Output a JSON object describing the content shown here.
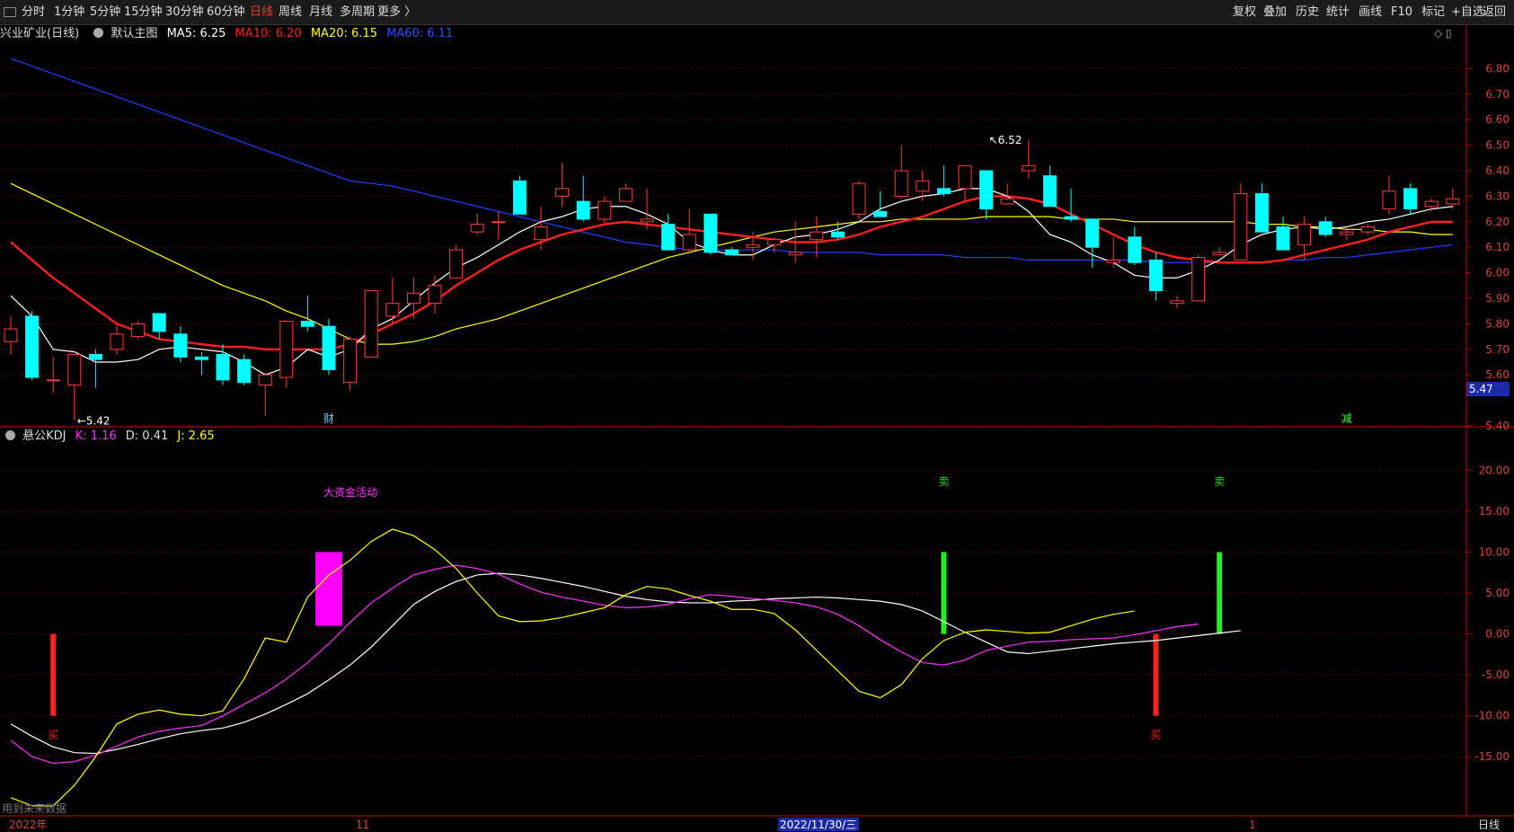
{
  "toolbar": {
    "periods": [
      "分时",
      "1分钟",
      "5分钟",
      "15分钟",
      "30分钟",
      "60分钟",
      "日线",
      "周线",
      "月线",
      "多周期",
      "更多 〉"
    ],
    "active_period": "日线",
    "right_buttons": [
      "复权",
      "叠加",
      "历史",
      "统计",
      "画线",
      "F10",
      "标记",
      "+自选",
      "返回"
    ]
  },
  "main_info": {
    "stock": "兴业矿业(日线)",
    "chart_label": "默认主图",
    "ma5": "MA5: 6.25",
    "ma10": "MA10: 6.20",
    "ma20": "MA20: 6.15",
    "ma60": "MA60: 6.11"
  },
  "kdj_info": {
    "name": "悬公KDJ",
    "k": "K: 1.16",
    "d": "D: 0.41",
    "j": "J: 2.65"
  },
  "price_tag": "5.47",
  "footer": {
    "left_note": "用到未来数据",
    "axis_labels": [
      "2022年",
      "11",
      "2022/11/30/三",
      "1"
    ],
    "period": "日线"
  },
  "colors": {
    "up": "#ff3d3d",
    "down": "#00ffff",
    "ma5": "#ffffff",
    "ma10": "#ff2020",
    "ma20": "#ffff00",
    "ma60": "#2040ff",
    "k": "#ffffff",
    "d": "#ff33ff",
    "j": "#ffff00",
    "grid": "#5a0000",
    "axis": "#c00000"
  },
  "chart_data": [
    {
      "type": "candlestick",
      "title": "兴业矿业(日线)",
      "ylim": [
        5.4,
        6.9
      ],
      "yticks": [
        "6.80",
        "6.70",
        "6.60",
        "6.50",
        "6.40",
        "6.30",
        "6.20",
        "6.10",
        "6.00",
        "5.90",
        "5.80",
        "5.70",
        "5.60",
        "5.40"
      ],
      "annotations": [
        {
          "text": "5.42",
          "candle": 3
        },
        {
          "text": "6.52",
          "candle": 46
        },
        {
          "text": "财",
          "candle": 15
        },
        {
          "text": "减",
          "candle": 63
        }
      ],
      "candles": [
        [
          5.73,
          5.78,
          5.68,
          5.83
        ],
        [
          5.83,
          5.59,
          5.58,
          5.85
        ],
        [
          5.58,
          5.58,
          5.53,
          5.67
        ],
        [
          5.56,
          5.68,
          5.42,
          5.68
        ],
        [
          5.68,
          5.66,
          5.55,
          5.7
        ],
        [
          5.7,
          5.76,
          5.68,
          5.8
        ],
        [
          5.75,
          5.8,
          5.74,
          5.81
        ],
        [
          5.84,
          5.77,
          5.74,
          5.84
        ],
        [
          5.76,
          5.67,
          5.65,
          5.79
        ],
        [
          5.67,
          5.66,
          5.6,
          5.69
        ],
        [
          5.68,
          5.58,
          5.56,
          5.72
        ],
        [
          5.66,
          5.57,
          5.56,
          5.68
        ],
        [
          5.56,
          5.6,
          5.44,
          5.61
        ],
        [
          5.59,
          5.81,
          5.55,
          5.81
        ],
        [
          5.81,
          5.79,
          5.77,
          5.91
        ],
        [
          5.79,
          5.62,
          5.6,
          5.82
        ],
        [
          5.57,
          5.74,
          5.54,
          5.75
        ],
        [
          5.67,
          5.93,
          5.67,
          5.93
        ],
        [
          5.83,
          5.88,
          5.8,
          5.98
        ],
        [
          5.88,
          5.92,
          5.82,
          5.98
        ],
        [
          5.88,
          5.95,
          5.84,
          5.99
        ],
        [
          5.98,
          6.09,
          5.99,
          6.11
        ],
        [
          6.16,
          6.19,
          6.15,
          6.23
        ],
        [
          6.2,
          6.2,
          6.13,
          6.24
        ],
        [
          6.36,
          6.23,
          6.23,
          6.38
        ],
        [
          6.13,
          6.18,
          6.09,
          6.26
        ],
        [
          6.3,
          6.33,
          6.26,
          6.43
        ],
        [
          6.28,
          6.21,
          6.2,
          6.38
        ],
        [
          6.21,
          6.28,
          6.19,
          6.3
        ],
        [
          6.28,
          6.33,
          6.3,
          6.35
        ],
        [
          6.2,
          6.21,
          6.17,
          6.33
        ],
        [
          6.19,
          6.09,
          6.09,
          6.23
        ],
        [
          6.09,
          6.15,
          6.08,
          6.25
        ],
        [
          6.23,
          6.08,
          6.07,
          6.23
        ],
        [
          6.09,
          6.07,
          6.07,
          6.1
        ],
        [
          6.1,
          6.11,
          6.05,
          6.16
        ],
        [
          6.11,
          6.13,
          6.08,
          6.14
        ],
        [
          6.07,
          6.08,
          6.04,
          6.2
        ],
        [
          6.13,
          6.16,
          6.06,
          6.22
        ],
        [
          6.16,
          6.14,
          6.13,
          6.2
        ],
        [
          6.23,
          6.35,
          6.21,
          6.36
        ],
        [
          6.24,
          6.22,
          6.22,
          6.32
        ],
        [
          6.3,
          6.4,
          6.29,
          6.5
        ],
        [
          6.32,
          6.36,
          6.28,
          6.4
        ],
        [
          6.33,
          6.31,
          6.3,
          6.42
        ],
        [
          6.33,
          6.42,
          6.28,
          6.42
        ],
        [
          6.4,
          6.25,
          6.21,
          6.4
        ],
        [
          6.27,
          6.29,
          6.28,
          6.35
        ],
        [
          6.4,
          6.42,
          6.37,
          6.52
        ],
        [
          6.38,
          6.26,
          6.26,
          6.42
        ],
        [
          6.22,
          6.21,
          6.2,
          6.33
        ],
        [
          6.21,
          6.1,
          6.02,
          6.21
        ],
        [
          6.04,
          6.05,
          6.02,
          6.14
        ],
        [
          6.14,
          6.04,
          6.03,
          6.18
        ],
        [
          6.05,
          5.93,
          5.89,
          6.08
        ],
        [
          5.88,
          5.89,
          5.86,
          5.91
        ],
        [
          5.89,
          6.06,
          5.9,
          6.07
        ],
        [
          6.07,
          6.08,
          6.08,
          6.1
        ],
        [
          6.05,
          6.31,
          6.05,
          6.35
        ],
        [
          6.31,
          6.16,
          6.16,
          6.35
        ],
        [
          6.18,
          6.09,
          6.1,
          6.22
        ],
        [
          6.11,
          6.19,
          6.05,
          6.22
        ],
        [
          6.2,
          6.15,
          6.14,
          6.22
        ],
        [
          6.15,
          6.16,
          6.13,
          6.18
        ],
        [
          6.16,
          6.18,
          6.15,
          6.19
        ],
        [
          6.25,
          6.32,
          6.23,
          6.38
        ],
        [
          6.33,
          6.25,
          6.23,
          6.35
        ],
        [
          6.26,
          6.28,
          6.24,
          6.29
        ],
        [
          6.27,
          6.29,
          6.25,
          6.33
        ]
      ],
      "ma5": [
        5.91,
        5.83,
        5.7,
        5.69,
        5.65,
        5.65,
        5.66,
        5.7,
        5.71,
        5.7,
        5.69,
        5.65,
        5.6,
        5.63,
        5.7,
        5.67,
        5.7,
        5.78,
        5.82,
        5.89,
        5.96,
        6.02,
        6.06,
        6.11,
        6.16,
        6.2,
        6.22,
        6.25,
        6.26,
        6.26,
        6.23,
        6.19,
        6.12,
        6.09,
        6.07,
        6.07,
        6.11,
        6.14,
        6.15,
        6.17,
        6.2,
        6.25,
        6.28,
        6.3,
        6.31,
        6.33,
        6.33,
        6.3,
        6.24,
        6.15,
        6.12,
        6.07,
        6.04,
        5.99,
        5.98,
        5.98,
        6.01,
        6.05,
        6.11,
        6.15,
        6.17,
        6.18,
        6.17,
        6.18,
        6.2,
        6.21,
        6.23,
        6.25,
        6.26
      ],
      "ma10": [
        6.12,
        6.05,
        5.98,
        5.92,
        5.86,
        5.8,
        5.77,
        5.74,
        5.73,
        5.72,
        5.71,
        5.71,
        5.7,
        5.7,
        5.7,
        5.7,
        5.72,
        5.76,
        5.8,
        5.84,
        5.89,
        5.95,
        6.0,
        6.05,
        6.09,
        6.12,
        6.15,
        6.17,
        6.19,
        6.2,
        6.19,
        6.18,
        6.17,
        6.16,
        6.15,
        6.14,
        6.13,
        6.12,
        6.12,
        6.13,
        6.15,
        6.18,
        6.2,
        6.22,
        6.25,
        6.28,
        6.3,
        6.3,
        6.29,
        6.27,
        6.23,
        6.19,
        6.15,
        6.11,
        6.08,
        6.06,
        6.05,
        6.04,
        6.04,
        6.04,
        6.05,
        6.07,
        6.09,
        6.11,
        6.13,
        6.16,
        6.18,
        6.2,
        6.2
      ],
      "ma20": [
        6.35,
        6.31,
        6.27,
        6.23,
        6.19,
        6.15,
        6.11,
        6.07,
        6.03,
        5.99,
        5.95,
        5.92,
        5.89,
        5.85,
        5.82,
        5.78,
        5.74,
        5.72,
        5.72,
        5.73,
        5.75,
        5.78,
        5.8,
        5.82,
        5.85,
        5.88,
        5.91,
        5.94,
        5.97,
        6.0,
        6.03,
        6.06,
        6.08,
        6.1,
        6.12,
        6.14,
        6.16,
        6.17,
        6.18,
        6.19,
        6.2,
        6.2,
        6.21,
        6.21,
        6.21,
        6.21,
        6.22,
        6.22,
        6.22,
        6.22,
        6.21,
        6.21,
        6.21,
        6.2,
        6.2,
        6.2,
        6.2,
        6.2,
        6.2,
        6.19,
        6.19,
        6.18,
        6.18,
        6.17,
        6.17,
        6.16,
        6.16,
        6.15,
        6.15
      ],
      "ma60": [
        6.84,
        6.81,
        6.78,
        6.75,
        6.72,
        6.69,
        6.66,
        6.63,
        6.6,
        6.57,
        6.54,
        6.51,
        6.48,
        6.45,
        6.42,
        6.39,
        6.36,
        6.35,
        6.34,
        6.32,
        6.3,
        6.28,
        6.26,
        6.24,
        6.22,
        6.2,
        6.18,
        6.16,
        6.14,
        6.12,
        6.11,
        6.1,
        6.09,
        6.09,
        6.09,
        6.09,
        6.09,
        6.08,
        6.08,
        6.08,
        6.08,
        6.07,
        6.07,
        6.07,
        6.07,
        6.06,
        6.06,
        6.06,
        6.05,
        6.05,
        6.05,
        6.05,
        6.05,
        6.05,
        6.04,
        6.04,
        6.04,
        6.04,
        6.04,
        6.04,
        6.05,
        6.05,
        6.06,
        6.06,
        6.07,
        6.08,
        6.09,
        6.1,
        6.11
      ]
    },
    {
      "type": "line",
      "title": "悬公KDJ",
      "ylim": [
        -22.0,
        23.0
      ],
      "yticks": [
        "20.00",
        "15.00",
        "10.00",
        "5.00",
        "0.00",
        "-5.00",
        "-10.00",
        "-15.00"
      ],
      "k": [
        -11.0,
        -12.5,
        -13.8,
        -14.5,
        -14.6,
        -14.1,
        -13.5,
        -12.8,
        -12.2,
        -11.8,
        -11.5,
        -10.8,
        -9.8,
        -8.6,
        -7.3,
        -5.6,
        -3.8,
        -1.6,
        1.0,
        3.6,
        5.2,
        6.4,
        7.2,
        7.4,
        7.2,
        6.8,
        6.3,
        5.8,
        5.2,
        4.6,
        4.2,
        3.9,
        3.8,
        3.8,
        4.0,
        4.1,
        4.3,
        4.4,
        4.5,
        4.4,
        4.2,
        4.0,
        3.6,
        2.8,
        1.5,
        0.2,
        -1.0,
        -2.2,
        -2.4,
        -2.1,
        -1.8,
        -1.5,
        -1.2,
        -1.0,
        -0.8,
        -0.5,
        -0.2,
        0.1,
        0.4
      ],
      "d": [
        -13.0,
        -15.0,
        -15.8,
        -15.6,
        -14.8,
        -13.7,
        -12.6,
        -11.9,
        -11.5,
        -11.2,
        -10.0,
        -8.6,
        -7.2,
        -5.5,
        -3.5,
        -1.2,
        1.4,
        3.8,
        5.6,
        7.2,
        7.9,
        8.4,
        8.0,
        7.3,
        6.1,
        5.1,
        4.5,
        4.0,
        3.5,
        3.2,
        3.3,
        3.6,
        4.3,
        4.8,
        4.6,
        4.3,
        4.1,
        3.8,
        3.3,
        2.4,
        1.0,
        -0.7,
        -2.2,
        -3.5,
        -3.8,
        -3.2,
        -2.0,
        -1.5,
        -1.0,
        -0.9,
        -0.7,
        -0.6,
        -0.5,
        -0.1,
        0.4,
        0.9,
        1.2
      ],
      "j": [
        -20.0,
        -21.0,
        -21.0,
        -18.5,
        -15.0,
        -11.0,
        -9.8,
        -9.3,
        -9.8,
        -10.0,
        -9.4,
        -5.5,
        -0.5,
        -1.0,
        4.5,
        7.2,
        9.0,
        11.3,
        12.8,
        12.0,
        10.3,
        8.0,
        5.0,
        2.2,
        1.5,
        1.6,
        2.0,
        2.6,
        3.2,
        4.8,
        5.8,
        5.5,
        4.7,
        4.0,
        3.0,
        3.0,
        2.5,
        0.5,
        -2.0,
        -4.5,
        -7.0,
        -7.8,
        -6.2,
        -3.0,
        -0.8,
        0.2,
        0.5,
        0.3,
        0.1,
        0.2,
        1.0,
        1.8,
        2.4,
        2.8
      ],
      "labels": [
        {
          "text": "买",
          "candle": 2,
          "color": "#ff2020",
          "pos": "bottom"
        },
        {
          "text": "大资金活动",
          "candle": 15,
          "color": "#ff33ff",
          "pos": "top"
        },
        {
          "text": "卖",
          "candle": 44,
          "color": "#22dd22",
          "pos": "top"
        },
        {
          "text": "买",
          "candle": 54,
          "color": "#ff2020",
          "pos": "bottom"
        },
        {
          "text": "卖",
          "candle": 57,
          "color": "#22dd22",
          "pos": "top"
        }
      ],
      "bars": [
        {
          "candle": 2,
          "from": 0,
          "to": -10,
          "color": "#ff2020"
        },
        {
          "candle": 15,
          "from": 1,
          "to": 10,
          "color": "#ff00ff"
        },
        {
          "candle": 44,
          "from": 0,
          "to": 10,
          "color": "#22ee22"
        },
        {
          "candle": 54,
          "from": 0,
          "to": -10,
          "color": "#ff2020"
        },
        {
          "candle": 57,
          "from": 0,
          "to": 10,
          "color": "#22ee22"
        }
      ]
    }
  ]
}
